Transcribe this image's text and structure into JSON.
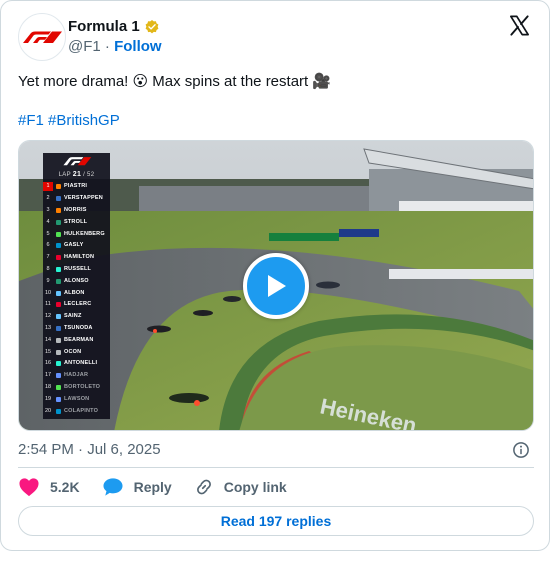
{
  "header": {
    "display_name": "Formula 1",
    "handle": "@F1",
    "separator": "·",
    "follow_label": "Follow"
  },
  "tweet": {
    "text": "Yet more drama! 😮 Max spins at the restart 🎥",
    "hashtags": [
      "#F1",
      "#BritishGP"
    ]
  },
  "media": {
    "type": "video",
    "timing_tower": {
      "lap_label": "LAP",
      "lap_current": "21",
      "lap_total": "/ 52",
      "rows": [
        {
          "pos": "1",
          "driver": "PIASTRI",
          "color": "#ff8000"
        },
        {
          "pos": "2",
          "driver": "VERSTAPPEN",
          "color": "#3671c6"
        },
        {
          "pos": "3",
          "driver": "NORRIS",
          "color": "#ff8000"
        },
        {
          "pos": "4",
          "driver": "STROLL",
          "color": "#229971"
        },
        {
          "pos": "5",
          "driver": "HULKENBERG",
          "color": "#52e252"
        },
        {
          "pos": "6",
          "driver": "GASLY",
          "color": "#0093cc"
        },
        {
          "pos": "7",
          "driver": "HAMILTON",
          "color": "#e8002d"
        },
        {
          "pos": "8",
          "driver": "RUSSELL",
          "color": "#27f4d2"
        },
        {
          "pos": "9",
          "driver": "ALONSO",
          "color": "#229971"
        },
        {
          "pos": "10",
          "driver": "ALBON",
          "color": "#64c4ff"
        },
        {
          "pos": "11",
          "driver": "LECLERC",
          "color": "#e8002d"
        },
        {
          "pos": "12",
          "driver": "SAINZ",
          "color": "#64c4ff"
        },
        {
          "pos": "13",
          "driver": "TSUNODA",
          "color": "#3671c6"
        },
        {
          "pos": "14",
          "driver": "BEARMAN",
          "color": "#b6babd"
        },
        {
          "pos": "15",
          "driver": "OCON",
          "color": "#b6babd"
        },
        {
          "pos": "16",
          "driver": "ANTONELLI",
          "color": "#27f4d2"
        },
        {
          "pos": "17",
          "driver": "HADJAR",
          "color": "#6692ff",
          "dim": true
        },
        {
          "pos": "18",
          "driver": "BORTOLETO",
          "color": "#52e252",
          "dim": true
        },
        {
          "pos": "19",
          "driver": "LAWSON",
          "color": "#6692ff",
          "dim": true
        },
        {
          "pos": "20",
          "driver": "COLAPINTO",
          "color": "#0093cc",
          "dim": true
        }
      ],
      "trackside_boards": [
        "Heineken",
        "Heineken",
        "Heineken"
      ]
    }
  },
  "meta": {
    "timestamp": "2:54 PM · Jul 6, 2025"
  },
  "actions": {
    "likes": "5.2K",
    "reply_label": "Reply",
    "copy_label": "Copy link"
  },
  "footer": {
    "read_replies_label": "Read 197 replies"
  },
  "colors": {
    "link": "#006fd6",
    "like": "#f91880",
    "verified": "#e2b719",
    "play": "#1d9bf0",
    "f1_red": "#e10600"
  },
  "icons": {
    "brand": "f1-logo",
    "platform": "x-logo",
    "verified": "verified-badge-icon",
    "info": "info-icon",
    "like": "heart-icon",
    "reply": "speech-bubble-icon",
    "copy": "link-icon",
    "play": "play-icon"
  }
}
